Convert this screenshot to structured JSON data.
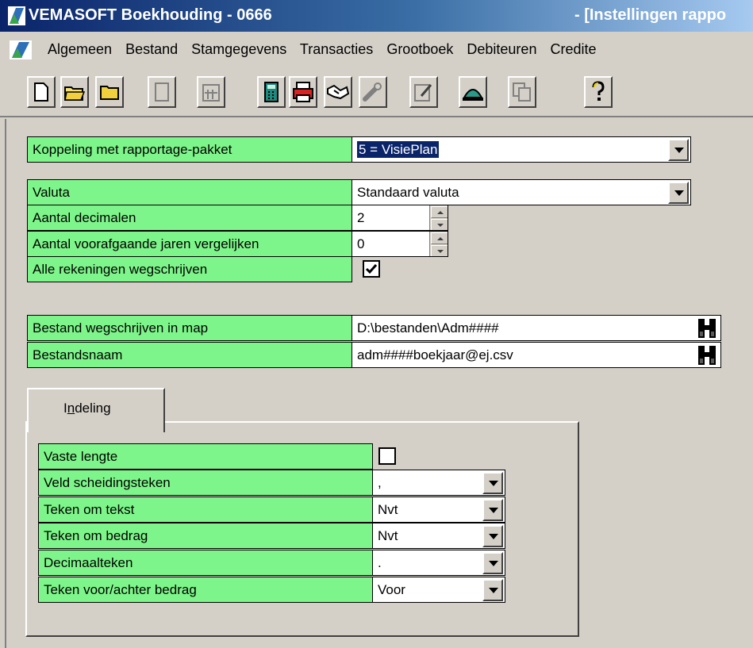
{
  "window": {
    "title_left": "VEMASOFT Boekhouding - 0666",
    "title_right": "- [Instellingen rappo"
  },
  "menu": {
    "items": [
      "Algemeen",
      "Bestand",
      "Stamgegevens",
      "Transacties",
      "Grootboek",
      "Debiteuren",
      "Credite"
    ]
  },
  "toolbar": {
    "buttons": [
      "new-document-icon",
      "open-folder-icon",
      "folder-icon",
      "blank-page-icon",
      "calendar-icon",
      "calculator-icon",
      "print-icon",
      "handshake-icon",
      "wrench-icon",
      "edit-icon",
      "user-icon",
      "copy-icon",
      "help-icon"
    ]
  },
  "form": {
    "koppeling": {
      "label": "Koppeling met rapportage-pakket",
      "value": "5 = VisiePlan"
    },
    "valuta": {
      "label": "Valuta",
      "value": "Standaard valuta"
    },
    "decimalen": {
      "label": "Aantal decimalen",
      "value": "2"
    },
    "jaren": {
      "label": "Aantal voorafgaande jaren vergelijken",
      "value": "0"
    },
    "alle_rekeningen": {
      "label": "Alle rekeningen wegschrijven",
      "checked": true
    },
    "map": {
      "label": "Bestand wegschrijven in map",
      "value": "D:\\bestanden\\Adm####"
    },
    "bestandsnaam": {
      "label": "Bestandsnaam",
      "value": "adm####boekjaar@ej.csv"
    }
  },
  "tabs": {
    "indeling": {
      "label": "Indeling"
    }
  },
  "indeling": {
    "vaste_lengte": {
      "label": "Vaste lengte",
      "checked": false
    },
    "scheidingsteken": {
      "label": "Veld scheidingsteken",
      "value": ","
    },
    "teken_tekst": {
      "label": "Teken om tekst",
      "value": "Nvt"
    },
    "teken_bedrag": {
      "label": "Teken om bedrag",
      "value": "Nvt"
    },
    "decimaalteken": {
      "label": "Decimaalteken",
      "value": "."
    },
    "voor_achter": {
      "label": "Teken voor/achter bedrag",
      "value": "Voor"
    }
  }
}
